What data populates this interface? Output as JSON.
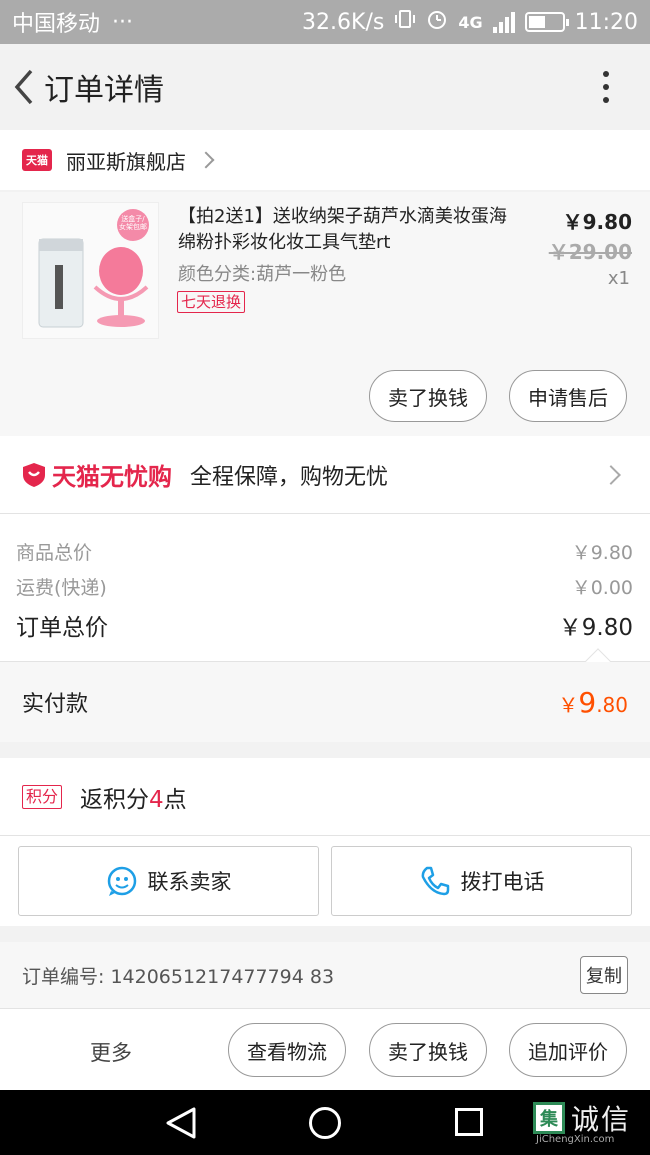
{
  "status_bar": {
    "carrier": "中国移动",
    "dots": "···",
    "speed": "32.6K/s",
    "network": "4G",
    "time": "11:20"
  },
  "header": {
    "title": "订单详情"
  },
  "store": {
    "badge": "天猫",
    "name": "丽亚斯旗舰店"
  },
  "product": {
    "name": "【拍2送1】送收纳架子葫芦水滴美妆蛋海绵粉扑彩妆化妆工具气垫rt",
    "attribute": "颜色分类:葫芦一粉色",
    "tag": "七天退换",
    "price": "￥9.80",
    "original_price": "￥29.00",
    "quantity": "x1",
    "thumb_sticker": "送盒子/女架包邮",
    "buttons": {
      "sell": "卖了换钱",
      "after_sales": "申请售后"
    }
  },
  "guarantee": {
    "brand": "天猫无忧购",
    "text": "全程保障，购物无忧"
  },
  "totals": {
    "goods_label": "商品总价",
    "goods_value": "￥9.80",
    "shipping_label": "运费(快递)",
    "shipping_value": "￥0.00",
    "order_label": "订单总价",
    "order_value": "￥9.80"
  },
  "paid": {
    "label": "实付款",
    "currency": "￥",
    "integer": "9",
    "decimal": ".80"
  },
  "points": {
    "badge": "积分",
    "prefix": "返积分",
    "count": "4",
    "suffix": "点"
  },
  "contact": {
    "seller": "联系卖家",
    "phone": "拨打电话"
  },
  "order_number": {
    "label": "订单编号: 1420651217477794 83",
    "copy": "复制"
  },
  "actions": {
    "more": "更多",
    "logistics": "查看物流",
    "sell": "卖了换钱",
    "review": "追加评价"
  },
  "watermark": {
    "icon_char": "集",
    "text": "诚信",
    "sub": "JiChengXin.com"
  },
  "colors": {
    "tmall_red": "#e4264c",
    "price_orange": "#ff5000",
    "accent_blue": "#1e9fe6"
  }
}
